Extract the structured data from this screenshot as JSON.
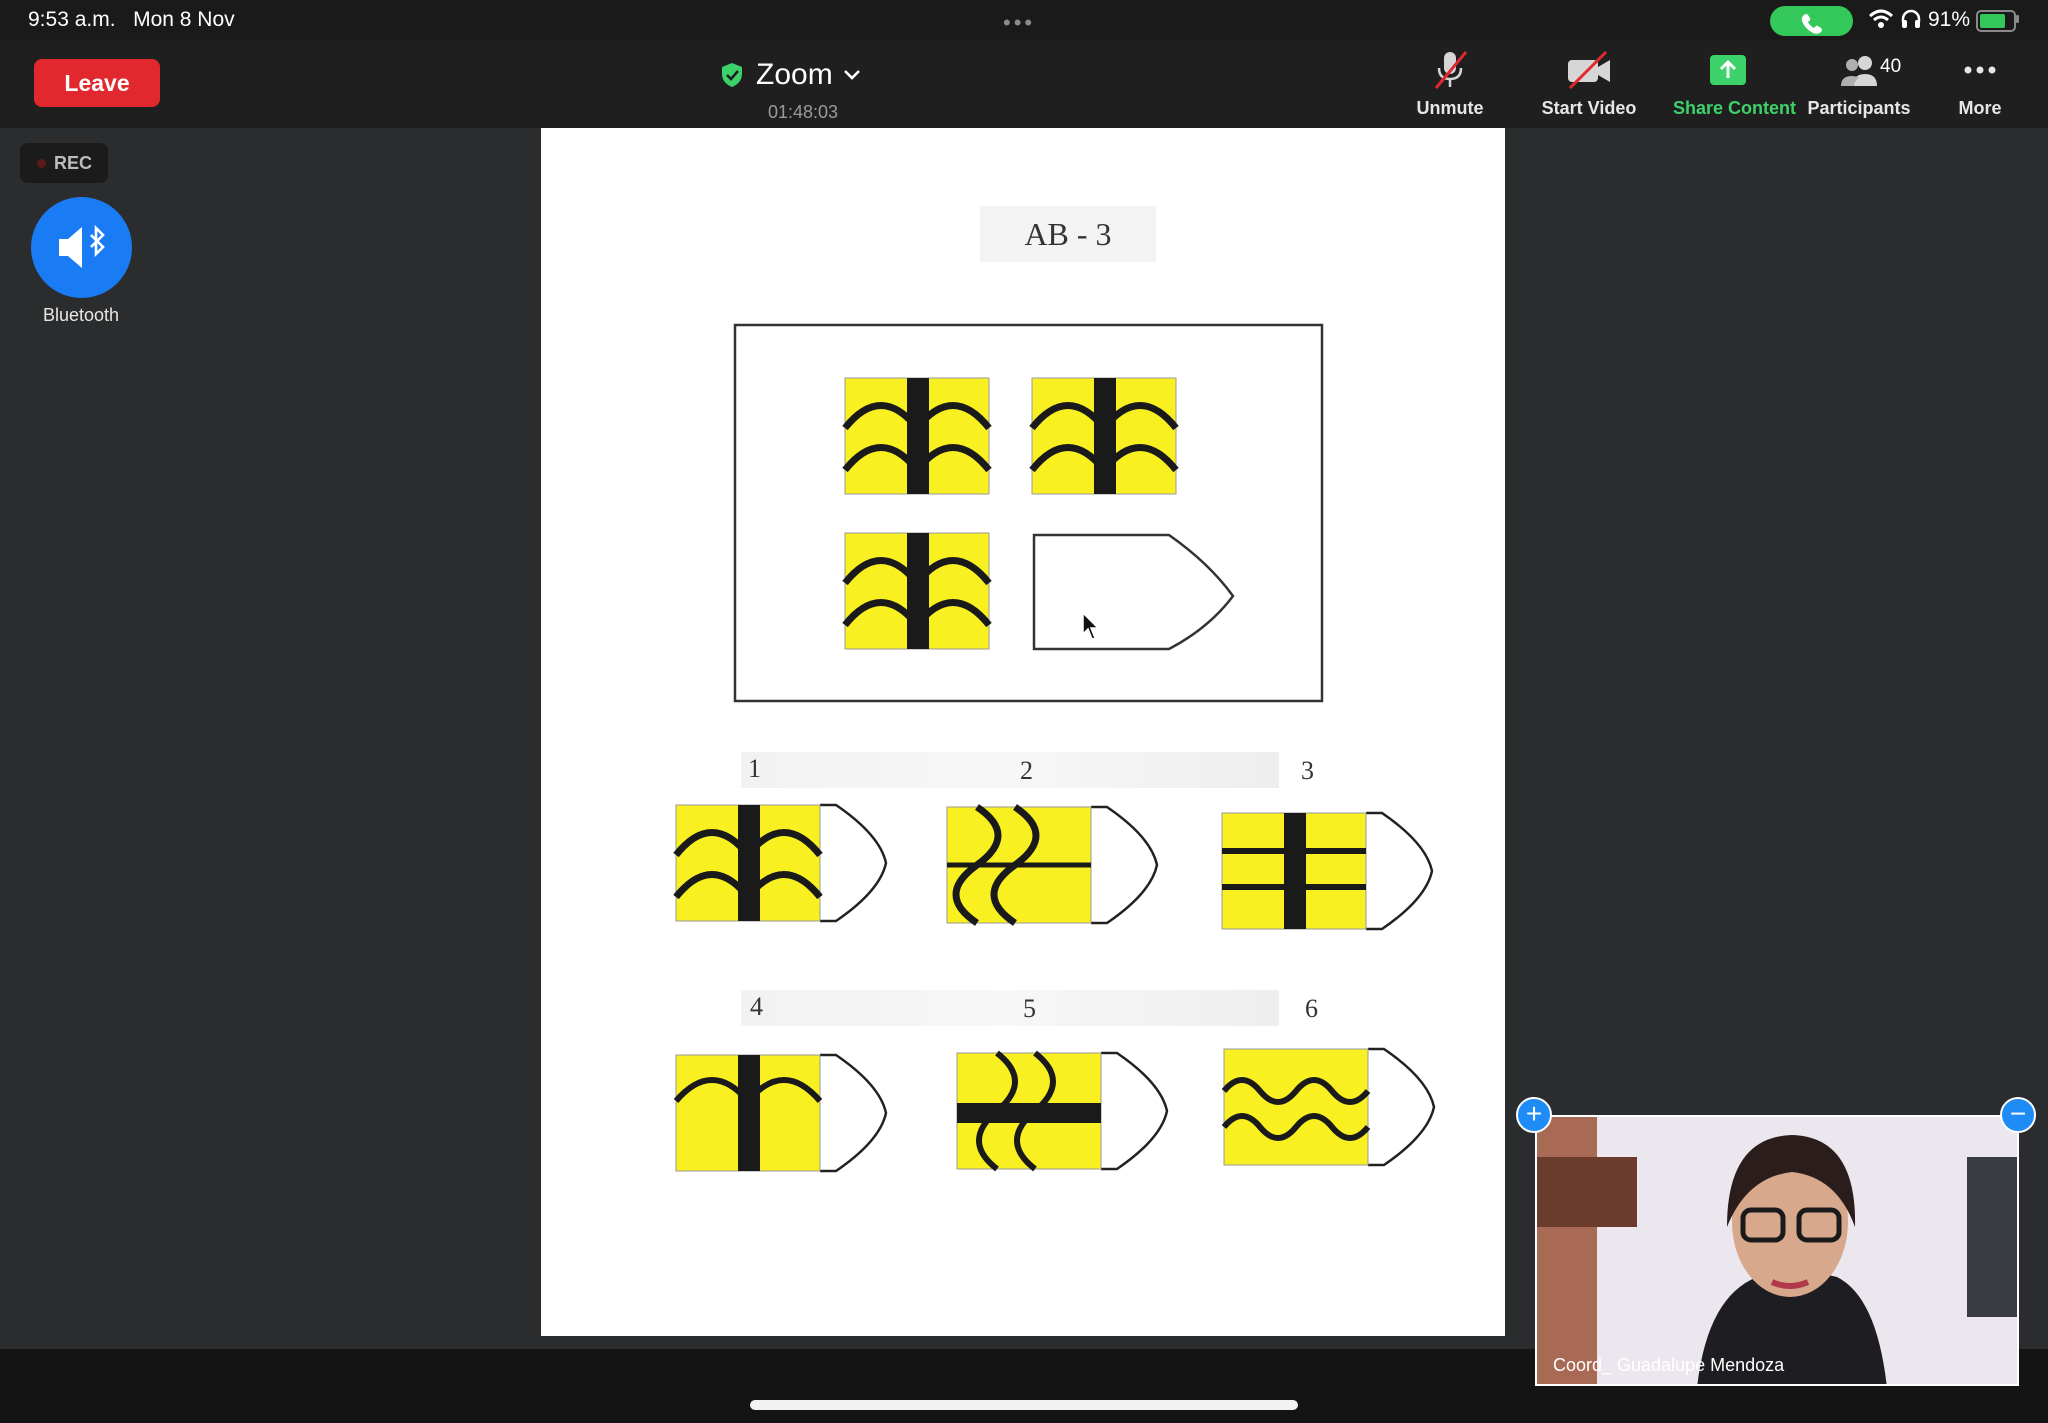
{
  "status_bar": {
    "time": "9:53 a.m.",
    "date": "Mon 8 Nov",
    "battery": "91%",
    "battery_level": 0.91,
    "call_color": "#34c759"
  },
  "toolbar": {
    "leave_label": "Leave",
    "meeting_name": "Zoom",
    "elapsed": "01:48:03",
    "unmute_label": "Unmute",
    "start_video_label": "Start Video",
    "share_label": "Share Content",
    "participants_label": "Participants",
    "participants_count": "40",
    "more_label": "More",
    "accent_red": "#e0282e",
    "accent_green": "#3dd16a"
  },
  "left_panel": {
    "rec_label": "REC",
    "audio_label": "Bluetooth",
    "audio_icon": "speaker-bluetooth-icon"
  },
  "shared_content": {
    "title": "AB - 3",
    "option_numbers": [
      "1",
      "2",
      "3",
      "4",
      "5",
      "6"
    ],
    "tile_color": "#f9f022"
  },
  "video_tile": {
    "participant_name": "Coord_ Guadalupe Mendoza"
  }
}
